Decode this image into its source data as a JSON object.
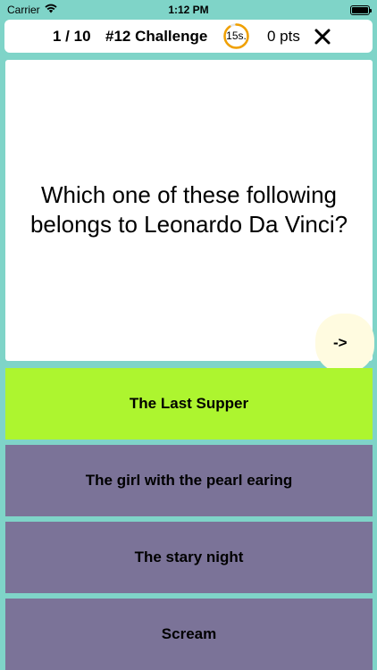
{
  "status_bar": {
    "carrier": "Carrier",
    "time": "1:12 PM"
  },
  "header": {
    "progress": "1 / 10",
    "title": "#12 Challenge",
    "timer": "15s.",
    "timer_remaining_fraction": 0.9,
    "points": "0 pts"
  },
  "question": {
    "text": "Which one of these following belongs to Leonardo Da Vinci?",
    "next_label": "->"
  },
  "answers": [
    {
      "label": "The Last Supper",
      "state": "correct"
    },
    {
      "label": "The girl with the pearl earing",
      "state": "default"
    },
    {
      "label": "The stary night",
      "state": "default"
    },
    {
      "label": "Scream",
      "state": "default"
    }
  ],
  "colors": {
    "background": "#7fd4c8",
    "correct_answer": "#adf52f",
    "answer": "#7b7398",
    "timer_ring": "#f0a000",
    "next_button": "#fffbe0"
  }
}
